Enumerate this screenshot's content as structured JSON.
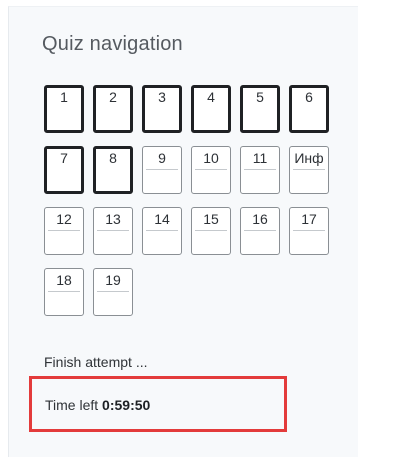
{
  "title": "Quiz navigation",
  "questions": [
    {
      "label": "1",
      "answered": true
    },
    {
      "label": "2",
      "answered": true
    },
    {
      "label": "3",
      "answered": true
    },
    {
      "label": "4",
      "answered": true
    },
    {
      "label": "5",
      "answered": true
    },
    {
      "label": "6",
      "answered": true
    },
    {
      "label": "7",
      "answered": true
    },
    {
      "label": "8",
      "answered": true
    },
    {
      "label": "9",
      "answered": false
    },
    {
      "label": "10",
      "answered": false
    },
    {
      "label": "11",
      "answered": false
    },
    {
      "label": "Инф",
      "answered": false
    },
    {
      "label": "12",
      "answered": false
    },
    {
      "label": "13",
      "answered": false
    },
    {
      "label": "14",
      "answered": false
    },
    {
      "label": "15",
      "answered": false
    },
    {
      "label": "16",
      "answered": false
    },
    {
      "label": "17",
      "answered": false
    },
    {
      "label": "18",
      "answered": false
    },
    {
      "label": "19",
      "answered": false
    }
  ],
  "finish_label": "Finish attempt ...",
  "timer": {
    "label": "Time left",
    "value": "0:59:50"
  },
  "colors": {
    "highlight_border": "#e33b3b",
    "panel_background": "#f7f9fb",
    "answered_border": "#1f2124"
  }
}
